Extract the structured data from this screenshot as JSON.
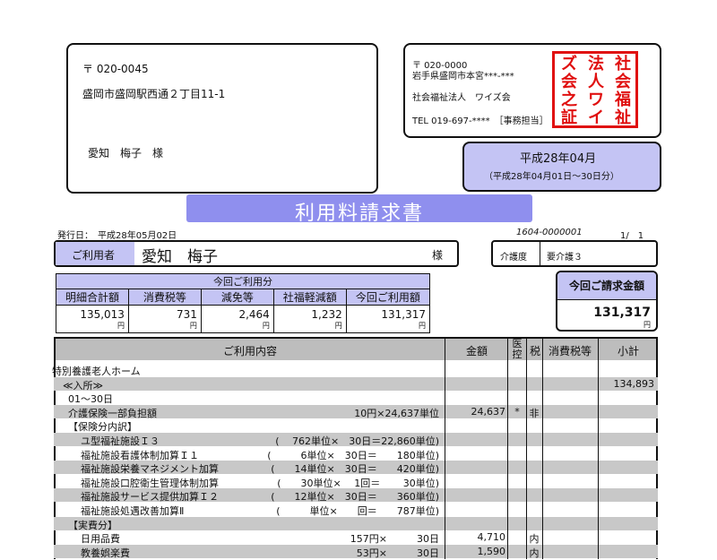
{
  "recipient": {
    "postal": "〒 020-0045",
    "address": "盛岡市盛岡駅西通２丁目11-1",
    "name": "愛知　梅子　様"
  },
  "sender": {
    "postal": "〒 020-0000",
    "address": "岩手県盛岡市本宮***-***",
    "org": "社会福祉法人　ワイズ会",
    "tel": "TEL 019-697-****　［事務担当］",
    "stamp_text": "社会福祉法人ワイズ会之証"
  },
  "period": {
    "month": "平成28年04月",
    "range": "（平成28年04月01日～30日分）"
  },
  "title": "利用料請求書",
  "issue_date": "発行日：　平成28年05月02日",
  "doc_no": "1604-0000001",
  "page": "1/　1",
  "user": {
    "label": "ご利用者",
    "name": "愛知　梅子",
    "suffix": "様"
  },
  "care": {
    "label": "介護度",
    "value": "要介護３"
  },
  "summary": {
    "heading": "今回ご利用分",
    "headers": [
      "明細合計額",
      "消費税等",
      "減免等",
      "社福軽減額",
      "今回ご利用額"
    ],
    "values": [
      "135,013",
      "731",
      "2,464",
      "1,232",
      "131,317"
    ],
    "unit": "円"
  },
  "request": {
    "label": "今回ご請求金額",
    "amount": "131,317",
    "unit": "円"
  },
  "table": {
    "headers": {
      "content": "ご利用内容",
      "amount": "金額",
      "deduct": "医控",
      "tax": "税",
      "ctax": "消費税等",
      "subtotal": "小計"
    },
    "rows": [
      {
        "text": "特別養護老人ホーム",
        "indent": 0,
        "detail": "",
        "amount": "",
        "deduct": "",
        "tax": "",
        "subtotal": "",
        "shade": false
      },
      {
        "text": "≪入所≫",
        "indent": 1,
        "detail": "",
        "amount": "",
        "deduct": "",
        "tax": "",
        "subtotal": "134,893",
        "shade": true
      },
      {
        "text": "01～30日",
        "indent": 2,
        "detail": "",
        "amount": "",
        "deduct": "",
        "tax": "",
        "subtotal": "",
        "shade": false
      },
      {
        "text": "介護保険一部負担額",
        "indent": 2,
        "detail": "10円×24,637単位",
        "amount": "24,637",
        "deduct": "*",
        "tax": "非",
        "subtotal": "",
        "shade": true
      },
      {
        "text": "【保険分内訳】",
        "indent": 2,
        "detail": "",
        "amount": "",
        "deduct": "",
        "tax": "",
        "subtotal": "",
        "shade": false
      },
      {
        "text": "ユ型福祉施設Ｉ３",
        "indent": 3,
        "detail": "(　 762単位×　30日＝22,860単位)",
        "amount": "",
        "deduct": "",
        "tax": "",
        "subtotal": "",
        "shade": true
      },
      {
        "text": "福祉施設看護体制加算Ｉ１",
        "indent": 3,
        "detail": "(　　　6単位×　30日＝　　180単位)",
        "amount": "",
        "deduct": "",
        "tax": "",
        "subtotal": "",
        "shade": false
      },
      {
        "text": "福祉施設栄養マネジメント加算",
        "indent": 3,
        "detail": "(　　14単位×　30日＝　　420単位)",
        "amount": "",
        "deduct": "",
        "tax": "",
        "subtotal": "",
        "shade": true
      },
      {
        "text": "福祉施設口腔衛生管理体制加算",
        "indent": 3,
        "detail": "(　　30単位×　 1回＝　　 30単位)",
        "amount": "",
        "deduct": "",
        "tax": "",
        "subtotal": "",
        "shade": false
      },
      {
        "text": "福祉施設サービス提供加算Ｉ２",
        "indent": 3,
        "detail": "(　　12単位×　30日＝　　360単位)",
        "amount": "",
        "deduct": "",
        "tax": "",
        "subtotal": "",
        "shade": true
      },
      {
        "text": "福祉施設処遇改善加算Ⅱ",
        "indent": 3,
        "detail": "(　　　単位×　　回＝　　787単位)",
        "amount": "",
        "deduct": "",
        "tax": "",
        "subtotal": "",
        "shade": false
      },
      {
        "text": "【実費分】",
        "indent": 2,
        "detail": "",
        "amount": "",
        "deduct": "",
        "tax": "",
        "subtotal": "",
        "shade": true
      },
      {
        "text": "日用品費",
        "indent": 3,
        "detail": "157円×　　　30日",
        "amount": "4,710",
        "deduct": "",
        "tax": "内",
        "subtotal": "",
        "shade": false
      },
      {
        "text": "教養娯楽費",
        "indent": 3,
        "detail": "53円×　　　30日",
        "amount": "1,590",
        "deduct": "",
        "tax": "内",
        "subtotal": "",
        "shade": true
      }
    ]
  }
}
